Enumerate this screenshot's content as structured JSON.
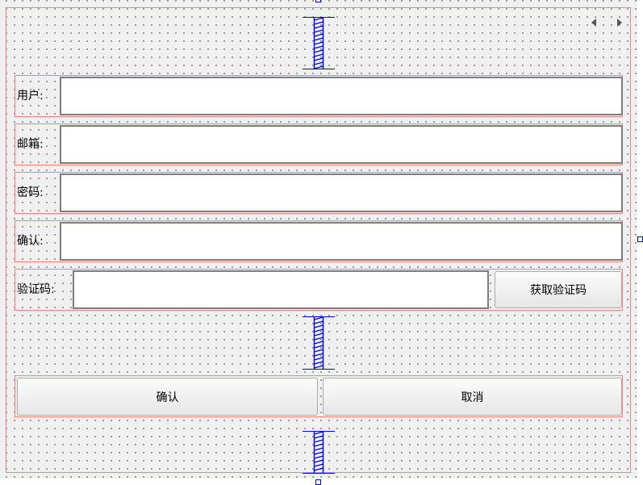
{
  "form": {
    "fields": [
      {
        "label": "用户:",
        "value": ""
      },
      {
        "label": "邮箱:",
        "value": ""
      },
      {
        "label": "密码:",
        "value": ""
      },
      {
        "label": "确认:",
        "value": ""
      }
    ],
    "captcha": {
      "label": "验证码:",
      "value": "",
      "button_label": "获取验证码"
    }
  },
  "actions": {
    "confirm_label": "确认",
    "cancel_label": "取消"
  },
  "icons": {
    "spacer": "vertical-spacer-icon",
    "nav_left": "triangle-left-icon",
    "nav_right": "triangle-right-icon"
  },
  "colors": {
    "canvas": "#f0f0f0",
    "layout_frame": "#ff7f7f",
    "spacer": "#0000ff"
  }
}
